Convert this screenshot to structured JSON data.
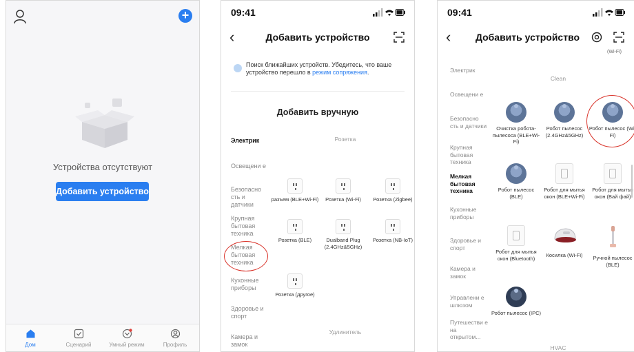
{
  "phone1": {
    "empty_text": "Устройства отсутствуют",
    "add_button": "Добавить устройство",
    "tabs": [
      {
        "label": "Дом",
        "icon": "home-icon",
        "active": true
      },
      {
        "label": "Сценарий",
        "icon": "scene-icon",
        "active": false
      },
      {
        "label": "Умный режим",
        "icon": "smart-mode-icon",
        "active": false
      },
      {
        "label": "Профиль",
        "icon": "profile-icon",
        "active": false
      }
    ]
  },
  "phone2": {
    "time": "09:41",
    "title": "Добавить устройство",
    "search_text": "Поиск ближайших устройств. Убедитесь, что ваше устройство перешло в",
    "search_link": "режим сопряжения",
    "search_end": ".",
    "manual_title": "Добавить вручную",
    "categories": [
      "Электрик",
      "Освещени е",
      "Безопасно сть и датчики",
      "Крупная бытовая техника",
      "Мелкая бытовая техника",
      "Кухонные приборы",
      "Здоровье и спорт",
      "Камера и замок"
    ],
    "section_socket": "Розетка",
    "section_extender": "Удлинитель",
    "devices": [
      "разъем (BLE+Wi-Fi)",
      "Розетка (Wi-Fi)",
      "Розетка (Zigbee)",
      "Розетка (BLE)",
      "Dualband Plug (2.4GHz&5GHz)",
      "Розетка (NB-IoT)",
      "Розетка (другое)"
    ]
  },
  "phone3": {
    "time": "09:41",
    "title": "Добавить устройство",
    "clip_label": "(Wi-Fi)",
    "categories": [
      "Электрик",
      "Освещени е",
      "Безопасно сть и датчики",
      "Крупная бытовая техника",
      "Мелкая бытовая техника",
      "Кухонные приборы",
      "Здоровье и спорт",
      "Камера и замок",
      "Управлени е шлюзом",
      "Путешестви е на открытом..."
    ],
    "section_clean": "Clean",
    "section_hvac": "HVAC",
    "devices": [
      "Очистка робота-пылесоса (BLE+Wi-Fi)",
      "Робот пылесос (2.4GHz&5GHz)",
      "Робот пылесос (Wi-Fi)",
      "Робот пылесос (BLE)",
      "Робот для мытья окон (BLE+Wi-Fi)",
      "Робот для мытья окон (Вай фай)",
      "Робот для мытья окон (Bluetooth)",
      "Косилка (Wi-Fi)",
      "Ручной пылесос (BLE)",
      "Робот пылесос (IPC)"
    ]
  },
  "colors": {
    "accent": "#2a7ef0",
    "highlight": "#d9342b"
  }
}
